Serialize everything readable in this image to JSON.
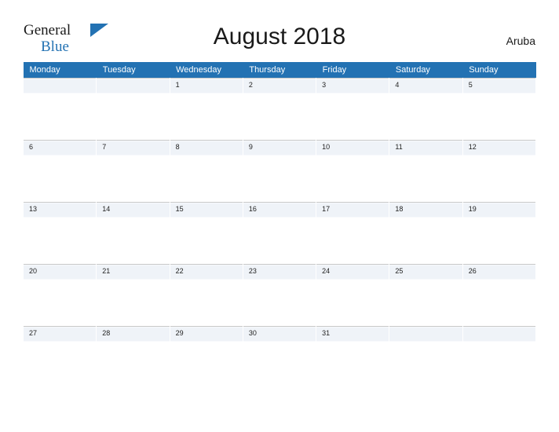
{
  "brand": {
    "word_one": "General",
    "word_two": "Blue",
    "flag_icon": "triangle-flag-icon",
    "accent_color": "#2372b3"
  },
  "header": {
    "title": "August 2018",
    "country": "Aruba"
  },
  "calendar": {
    "weekday_headers": [
      "Monday",
      "Tuesday",
      "Wednesday",
      "Thursday",
      "Friday",
      "Saturday",
      "Sunday"
    ],
    "header_bg": "#2372b3",
    "row_band_color": "#eff3f8",
    "weeks": [
      [
        "",
        "",
        "1",
        "2",
        "3",
        "4",
        "5"
      ],
      [
        "6",
        "7",
        "8",
        "9",
        "10",
        "11",
        "12"
      ],
      [
        "13",
        "14",
        "15",
        "16",
        "17",
        "18",
        "19"
      ],
      [
        "20",
        "21",
        "22",
        "23",
        "24",
        "25",
        "26"
      ],
      [
        "27",
        "28",
        "29",
        "30",
        "31",
        "",
        ""
      ]
    ]
  }
}
